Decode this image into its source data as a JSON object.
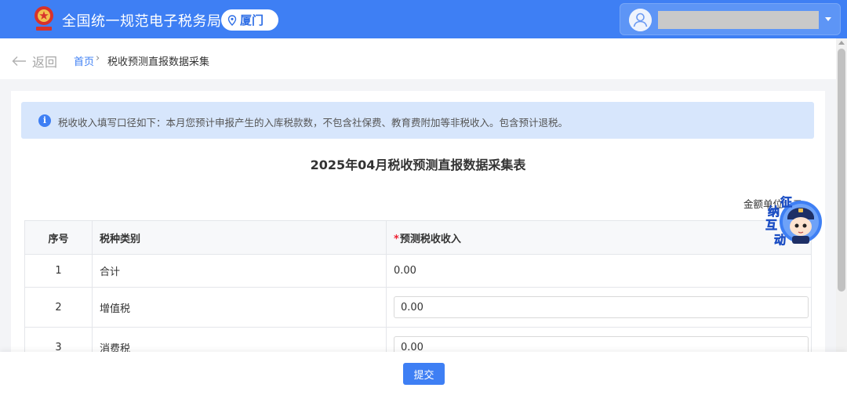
{
  "header": {
    "site_title": "全国统一规范电子税务局",
    "city": "厦门",
    "user_name": ""
  },
  "breadcrumb": {
    "back_label": "返回",
    "home": "首页",
    "separator": "›",
    "current": "税收预测直报数据采集"
  },
  "notice": {
    "icon_glyph": "i",
    "text": "税收收入填写口径如下：本月您预计申报产生的入库税款数，不包含社保费、教育费附加等非税收入。包含预计退税。"
  },
  "form": {
    "title": "2025年04月税收预测直报数据采集表",
    "unit_label": "金额单位：元"
  },
  "table": {
    "headers": {
      "index": "序号",
      "tax_type": "税种类别",
      "required_mark": "*",
      "amount": "预测税收收入"
    },
    "rows": [
      {
        "index": "1",
        "tax_type": "合计",
        "amount": "0.00"
      },
      {
        "index": "2",
        "tax_type": "增值税",
        "amount": "0.00"
      },
      {
        "index": "3",
        "tax_type": "消费税",
        "amount": "0.00"
      }
    ]
  },
  "mascot": {
    "chars": [
      "征",
      "纳",
      "互",
      "动"
    ]
  },
  "footer": {
    "submit_label": "提交"
  },
  "colors": {
    "brand_blue": "#3e7ff4",
    "notice_bg": "#d7e6fc",
    "required_red": "#e23"
  }
}
